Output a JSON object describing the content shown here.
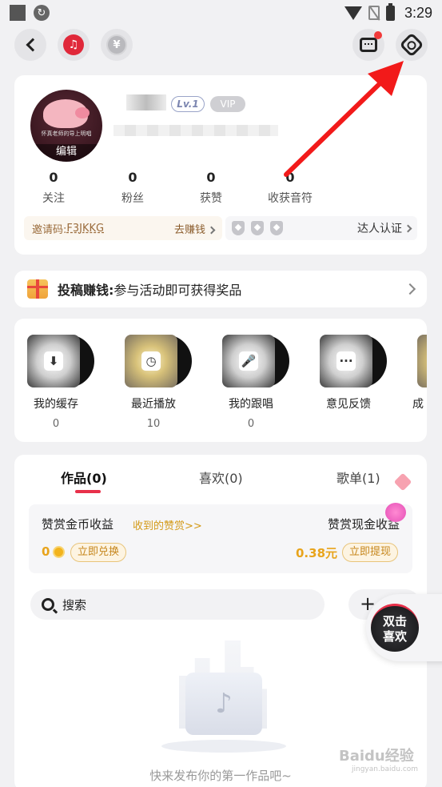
{
  "status_bar": {
    "time": "3:29"
  },
  "header": {
    "yuan_symbol": "¥",
    "music_symbol": "♫"
  },
  "profile": {
    "avatar_caption": "怀真老师的导上明唱",
    "avatar_edit_label": "编辑",
    "level": "Lv.1",
    "vip": "VIP",
    "stats": [
      {
        "count": "0",
        "label": "关注"
      },
      {
        "count": "0",
        "label": "粉丝"
      },
      {
        "count": "0",
        "label": "获赞"
      },
      {
        "count": "0",
        "label": "收获音符"
      }
    ],
    "invite_label": "邀请码:",
    "invite_code": "F3JKKG",
    "invite_action": "去赚钱",
    "talent_label": "达人认证"
  },
  "promo": {
    "bold": "投稿赚钱:",
    "text": "参与活动即可获得奖品"
  },
  "tools": [
    {
      "label": "我的缓存",
      "count": "0",
      "glyph": "⬇"
    },
    {
      "label": "最近播放",
      "count": "10",
      "glyph": "◷"
    },
    {
      "label": "我的跟唱",
      "count": "0",
      "glyph": "🎤"
    },
    {
      "label": "意见反馈",
      "count": "",
      "glyph": "···"
    },
    {
      "label": "成",
      "count": "",
      "glyph": ""
    }
  ],
  "works": {
    "tabs": [
      "作品(0)",
      "喜欢(0)",
      "歌单(1)"
    ],
    "reward": {
      "coin_title": "赞赏金币收益",
      "coin_link": "收到的赞赏>>",
      "coin_value": "0",
      "coin_button": "立即兑换",
      "cash_title": "赞赏现金收益",
      "cash_value": "0.38元",
      "cash_button": "立即提现"
    },
    "search_placeholder": "搜索",
    "add_label": "+",
    "empty_text": "快来发布你的第一作品吧~"
  },
  "float_button": {
    "line1": "双击",
    "line2": "喜欢"
  },
  "watermark": {
    "main": "Baidu经验",
    "sub": "jingyan.baidu.com"
  },
  "colors": {
    "accent": "#e8304a",
    "gold": "#e8a41c",
    "arrow": "#f21a1a"
  }
}
